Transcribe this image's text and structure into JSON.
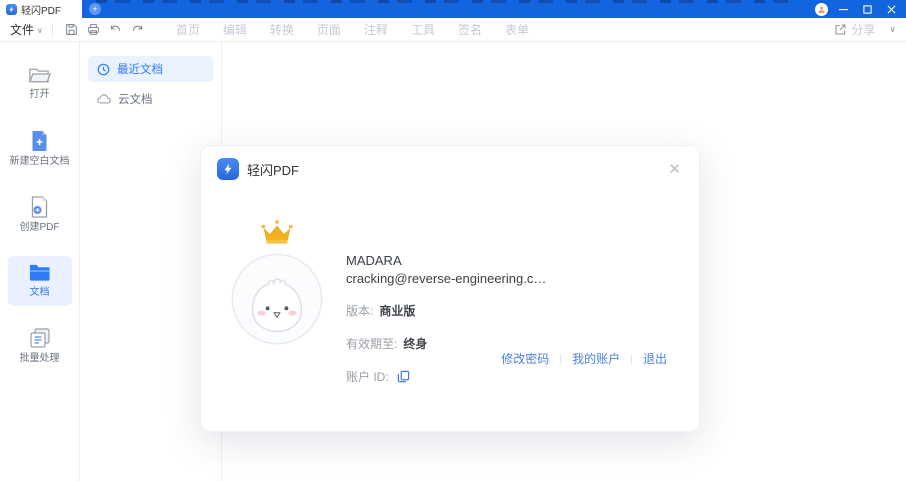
{
  "titlebar": {
    "tab_title": "轻闪PDF",
    "newtab_glyph": "+"
  },
  "toolbar": {
    "file_label": "文件",
    "menu_items": [
      "首页",
      "编辑",
      "转换",
      "页面",
      "注释",
      "工具",
      "签名",
      "表单"
    ],
    "share_label": "分享"
  },
  "sidebar": {
    "items": [
      {
        "label": "打开",
        "icon": "open-folder-icon",
        "active": false
      },
      {
        "label": "新建空白文档",
        "icon": "new-blank-doc-icon",
        "active": false
      },
      {
        "label": "创建PDF",
        "icon": "create-pdf-icon",
        "active": false
      },
      {
        "label": "文档",
        "icon": "documents-folder-icon",
        "active": true
      },
      {
        "label": "批量处理",
        "icon": "batch-process-icon",
        "active": false
      }
    ]
  },
  "panel": {
    "items": [
      {
        "label": "最近文档",
        "icon": "clock-icon",
        "active": true
      },
      {
        "label": "云文档",
        "icon": "cloud-icon",
        "active": false
      }
    ]
  },
  "dialog": {
    "title": "轻闪PDF",
    "close_glyph": "✕",
    "account": {
      "name": "MADARA",
      "email": "cracking@reverse-engineering.c…",
      "version_label": "版本:",
      "version_value": "商业版",
      "expiry_label": "有效期至:",
      "expiry_value": "终身",
      "account_id_label": "账户 ID:"
    },
    "links": [
      "修改密码",
      "我的账户",
      "退出"
    ]
  },
  "colors": {
    "titlebar_blue": "#1365DF",
    "accent_blue": "#2F7BF5",
    "link_blue": "#4D7FE0",
    "active_item_bg": "#EAF2FE",
    "crown_gold": "#F2B01E"
  }
}
